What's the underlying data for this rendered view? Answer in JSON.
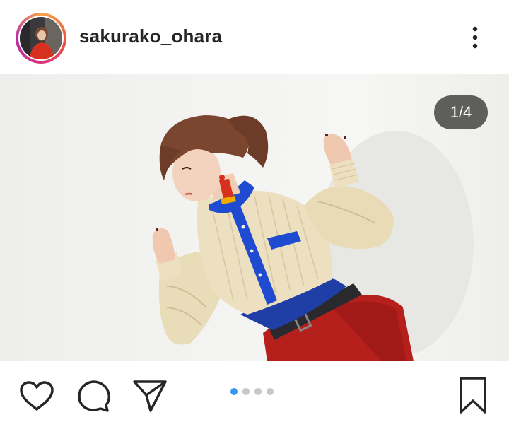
{
  "post": {
    "username": "sakurako_ohara",
    "image_counter": "1/4",
    "total_images": 4,
    "active_image_index": 0
  },
  "colors": {
    "accent": "#3897f0",
    "text": "#262626",
    "dot_inactive": "#c7c7c7"
  },
  "icons": {
    "more": "more-vertical-icon",
    "like": "heart-icon",
    "comment": "comment-icon",
    "share": "paper-plane-icon",
    "save": "bookmark-icon"
  }
}
